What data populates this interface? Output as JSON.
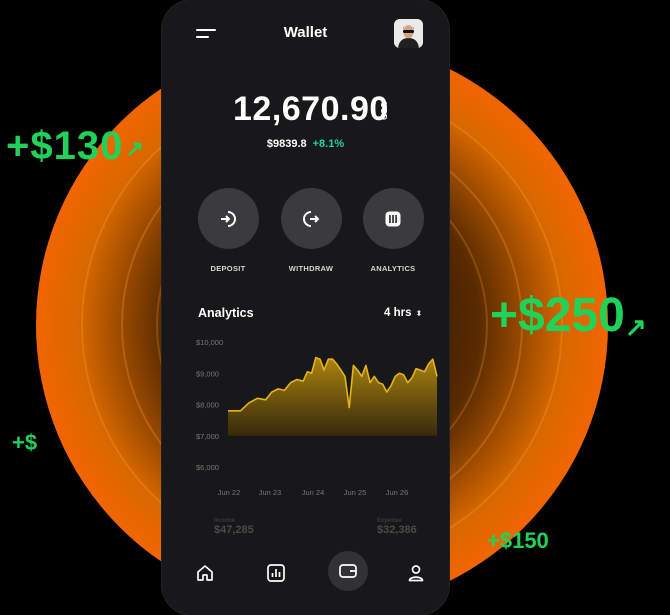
{
  "background": {
    "glow_color": "#ff7a00",
    "accent_green": "#1fd35a"
  },
  "floating": {
    "left_amount": "+$130",
    "right_amount": "+$250",
    "arrow": "↗",
    "small_left": "+$",
    "small_right": "+$150"
  },
  "app": {
    "title": "Wallet"
  },
  "balance": {
    "value": "12,670.90",
    "currency": "USD",
    "usd_value": "$9839.8",
    "change": "+8.1%"
  },
  "actions": [
    {
      "label": "DEPOSIT",
      "icon": "deposit-icon"
    },
    {
      "label": "WITHDRAW",
      "icon": "withdraw-icon"
    },
    {
      "label": "ANALYTICS",
      "icon": "analytics-icon"
    }
  ],
  "analytics": {
    "title": "Analytics",
    "range": "4 hrs",
    "range_icon": "up-down-icon"
  },
  "chart_data": {
    "type": "area",
    "y_ticks": [
      "$10,000",
      "$9,000",
      "$8,000",
      "$7,000",
      "$6,000"
    ],
    "ylim": [
      6000,
      10000
    ],
    "x_ticks": [
      "Jun 22",
      "Jun 23",
      "Jun 24",
      "Jun 25",
      "Jun 26"
    ],
    "xlim": [
      0,
      100
    ],
    "series": [
      {
        "color": "#e7b416",
        "points": [
          [
            0,
            7800
          ],
          [
            6,
            7800
          ],
          [
            10,
            8050
          ],
          [
            14,
            8200
          ],
          [
            18,
            8150
          ],
          [
            21,
            8400
          ],
          [
            24,
            8500
          ],
          [
            27,
            8450
          ],
          [
            30,
            8700
          ],
          [
            33,
            8800
          ],
          [
            36,
            8750
          ],
          [
            38,
            9050
          ],
          [
            40,
            9000
          ],
          [
            42,
            9500
          ],
          [
            44,
            9450
          ],
          [
            46,
            9100
          ],
          [
            48,
            9450
          ],
          [
            50,
            9450
          ],
          [
            52,
            9300
          ],
          [
            54,
            9100
          ],
          [
            56,
            8900
          ],
          [
            58,
            7900
          ],
          [
            60,
            9250
          ],
          [
            62,
            9100
          ],
          [
            64,
            8900
          ],
          [
            66,
            9250
          ],
          [
            68,
            8700
          ],
          [
            70,
            8900
          ],
          [
            72,
            8700
          ],
          [
            74,
            8650
          ],
          [
            76,
            8400
          ],
          [
            78,
            8600
          ],
          [
            80,
            8900
          ],
          [
            82,
            9000
          ],
          [
            84,
            8950
          ],
          [
            86,
            8700
          ],
          [
            88,
            8850
          ],
          [
            90,
            9150
          ],
          [
            92,
            9100
          ],
          [
            94,
            9050
          ],
          [
            96,
            9300
          ],
          [
            98,
            9450
          ],
          [
            100,
            8900
          ]
        ]
      }
    ]
  },
  "faded": {
    "left": "$47,285",
    "right": "$32,386",
    "left_caption": "Income",
    "right_caption": "Expense"
  },
  "nav": [
    {
      "name": "home-icon"
    },
    {
      "name": "stats-icon"
    },
    {
      "name": "wallet-icon"
    },
    {
      "name": "profile-icon"
    }
  ]
}
